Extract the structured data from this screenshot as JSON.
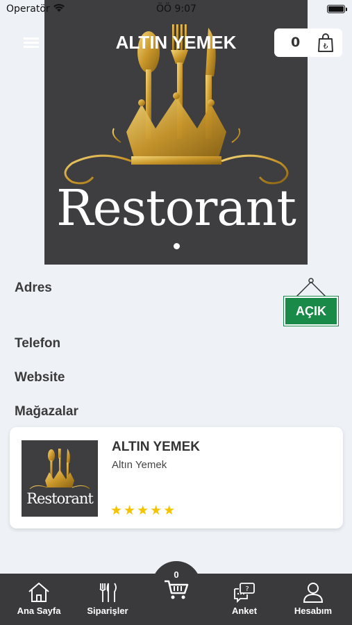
{
  "status_bar": {
    "carrier": "Operatör",
    "time": "ÖÖ 9:07"
  },
  "header": {
    "title": "ALTIN YEMEK",
    "cart_count": "0",
    "menu_icon": "hamburger-icon",
    "cart_icon": "shopping-bag-lira-icon"
  },
  "hero": {
    "image_text": "Restorant",
    "slide_count": 1,
    "active_slide": 1
  },
  "info": {
    "address_label": "Adres",
    "phone_label": "Telefon",
    "website_label": "Website",
    "stores_label": "Mağazalar",
    "status_sign": "AÇIK",
    "status_color": "#1a8a48"
  },
  "stores": [
    {
      "name": "ALTIN YEMEK",
      "subtitle": "Altın Yemek",
      "thumb_text": "Restorant",
      "rating": 5,
      "stars": "★★★★★"
    }
  ],
  "tabbar": {
    "home_label": "Ana Sayfa",
    "orders_label": "Siparişler",
    "cart_count": "0",
    "survey_label": "Anket",
    "account_label": "Hesabım"
  },
  "colors": {
    "dark": "#3a3a3c",
    "accent_gold": "#d4a72c",
    "star": "#f5c400",
    "background": "#eef2f6"
  }
}
